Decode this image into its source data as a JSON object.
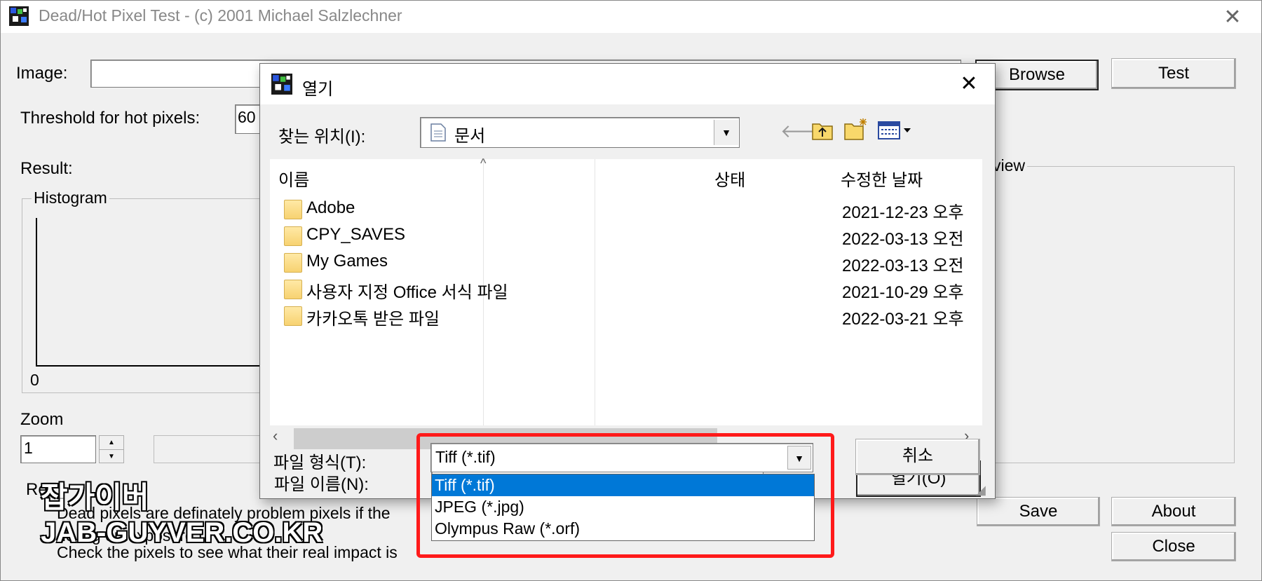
{
  "window": {
    "title": "Dead/Hot Pixel Test - (c) 2001 Michael Salzlechner",
    "close_glyph": "✕"
  },
  "main": {
    "image_label": "Image:",
    "image_value": "",
    "threshold_label": "Threshold for hot pixels:",
    "threshold_value": "60",
    "result_label": "Result:",
    "histogram_label": "Histogram",
    "histogram_axis_zero": "0",
    "zoom_label": "Zoom",
    "zoom_value": "1",
    "preview_label": "view",
    "results_label": "Re",
    "text_lines": [
      "Dead pixels are definately problem pixels if the",
      "de                         ing on exposure t",
      "Check the pixels to see what their real impact is"
    ],
    "buttons": {
      "browse": "Browse",
      "test": "Test",
      "save": "Save",
      "about": "About",
      "close": "Close"
    }
  },
  "dialog": {
    "title": "열기",
    "look_in_label": "찾는 위치(I):",
    "look_in_value": "문서",
    "columns": {
      "name": "이름",
      "status": "상태",
      "modified": "수정한 날짜"
    },
    "files": [
      {
        "name": "Adobe",
        "status": "",
        "modified": "2021-12-23 오후"
      },
      {
        "name": "CPY_SAVES",
        "status": "",
        "modified": "2022-03-13 오전"
      },
      {
        "name": "My Games",
        "status": "",
        "modified": "2022-03-13 오전"
      },
      {
        "name": "사용자 지정 Office 서식 파일",
        "status": "",
        "modified": "2021-10-29 오후"
      },
      {
        "name": "카카오톡 받은 파일",
        "status": "",
        "modified": "2022-03-21 오후"
      }
    ],
    "filename_label": "파일 이름(N):",
    "filename_value": "",
    "filetype_label": "파일 형식(T):",
    "filetype_value": "Tiff (*.tif)",
    "filetype_options": [
      "Tiff (*.tif)",
      "JPEG (*.jpg)",
      "Olympus Raw (*.orf)"
    ],
    "selected_option_index": 0,
    "open_button": "열기(O)",
    "cancel_button": "취소",
    "close_glyph": "✕"
  },
  "watermark": {
    "line1": "잡가이버",
    "line2": "JAB-GUYVER.CO.KR"
  },
  "colors": {
    "highlight": "#ff1a1a",
    "selection": "#0078d7",
    "window_bg": "#f0f0f0"
  },
  "icons": {
    "app": "pixel-test-app-icon",
    "dialog": "pixel-test-app-icon",
    "document": "document-icon",
    "folder": "folder-icon",
    "back": "back-arrow-icon",
    "up": "up-folder-icon",
    "new_folder": "new-folder-icon",
    "view": "view-menu-icon"
  }
}
